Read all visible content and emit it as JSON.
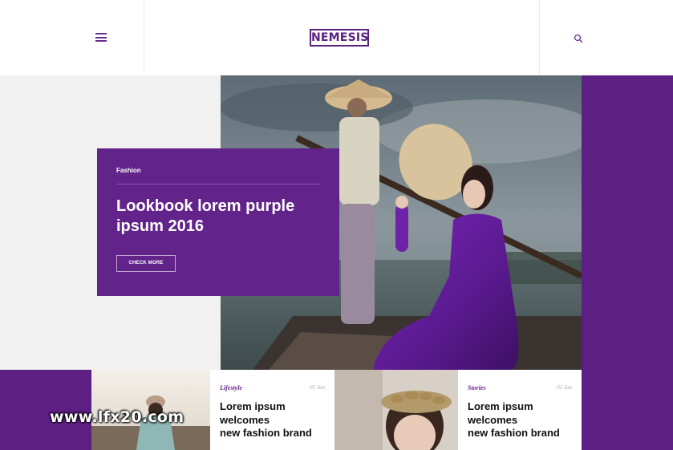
{
  "header": {
    "logo": "NEMESIS",
    "menu_icon": "hamburger-menu-icon",
    "search_icon": "search-icon"
  },
  "hero": {
    "image": "photo-woman-purple-ao-dai-conical-hat-on-boat",
    "card": {
      "category": "Fashion",
      "title": "Lookbook lorem purple ipsum 2016",
      "button_label": "CHECK MORE"
    }
  },
  "posts": [
    {
      "category": "Lifestyle",
      "date": "02 Jan",
      "title_lines": [
        "Lorem ipsum",
        "welcomes",
        "new fashion brand"
      ],
      "image": "photo-woman-hat-outdoors"
    },
    {
      "category": "Stories",
      "date": "02 Jan",
      "title_lines": [
        "Lorem ipsum",
        "welcomes",
        "new fashion brand"
      ],
      "image": "photo-woman-flower-headband"
    }
  ],
  "watermark": "www.lfx20.com",
  "colors": {
    "brand_purple": "#5e1f84",
    "card_purple": "#62238a",
    "light_gray": "#f1f1f1"
  }
}
